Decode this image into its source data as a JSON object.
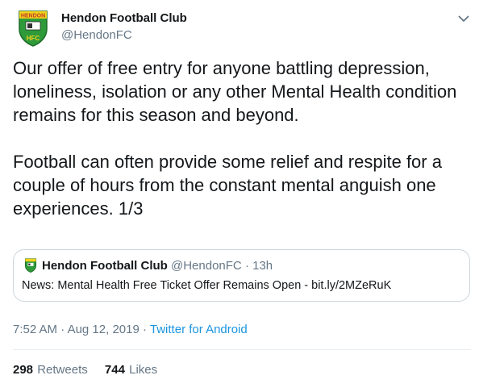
{
  "author": {
    "name": "Hendon Football Club",
    "handle": "@HendonFC",
    "crest_text": "HENDON",
    "crest_letters": "HFC"
  },
  "tweet": {
    "paragraphs": [
      "Our offer of free entry for anyone battling depression, loneliness, isolation or any other Mental Health condition remains for this season and beyond.",
      "Football can often provide some relief and respite for a couple of hours from the constant mental anguish one experiences. 1/3"
    ]
  },
  "quote": {
    "name": "Hendon Football Club",
    "handle": "@HendonFC",
    "separator": "·",
    "time": "13h",
    "text": "News: Mental Health Free Ticket Offer Remains Open - bit.ly/2MZeRuK"
  },
  "meta": {
    "time": "7:52 AM",
    "date": "Aug 12, 2019",
    "separator": "·",
    "source": "Twitter for Android"
  },
  "stats": {
    "retweets_count": "298",
    "retweets_label": "Retweets",
    "likes_count": "744",
    "likes_label": "Likes"
  },
  "colors": {
    "text": "#14171a",
    "secondary": "#657786",
    "link": "#1b95e0",
    "border": "#ccd6dd",
    "crest_green": "#2e9a3a",
    "crest_yellow": "#f2d21a"
  },
  "icons": {
    "caret": "chevron-down-icon",
    "avatar": "club-crest-icon"
  }
}
